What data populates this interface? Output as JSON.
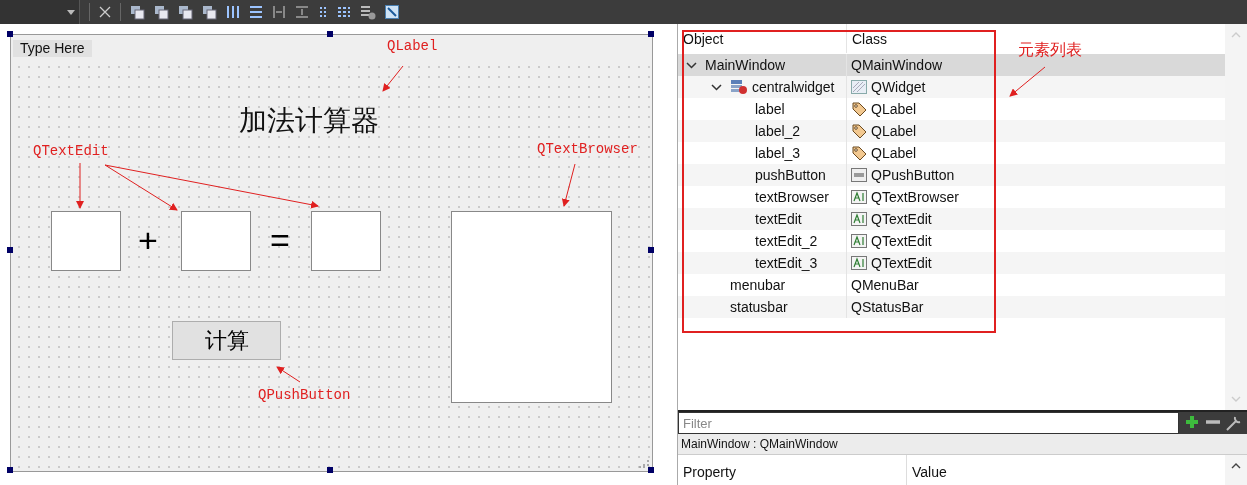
{
  "form": {
    "menu_placeholder": "Type Here",
    "title": "加法计算器",
    "operators": [
      "+",
      "="
    ],
    "button": "计算"
  },
  "annotations": [
    {
      "text": "QLabel"
    },
    {
      "text": "QTextEdit"
    },
    {
      "text": "QTextBrowser"
    },
    {
      "text": "QPushButton"
    },
    {
      "text": "元素列表"
    }
  ],
  "object_inspector": {
    "columns": [
      "Object",
      "Class"
    ],
    "tree": [
      {
        "name": "MainWindow",
        "class": "QMainWindow",
        "expanded": true,
        "selected": true,
        "children": [
          {
            "name": "centralwidget",
            "class": "QWidget",
            "kind": "widget",
            "expanded": true,
            "selected": false,
            "children": [
              {
                "name": "label",
                "class": "QLabel",
                "kind": "label",
                "selected": false
              },
              {
                "name": "label_2",
                "class": "QLabel",
                "kind": "label",
                "selected": false
              },
              {
                "name": "label_3",
                "class": "QLabel",
                "kind": "label",
                "selected": false
              },
              {
                "name": "pushButton",
                "class": "QPushButton",
                "kind": "button",
                "selected": false
              },
              {
                "name": "textBrowser",
                "class": "QTextBrowser",
                "kind": "text",
                "selected": false
              },
              {
                "name": "textEdit",
                "class": "QTextEdit",
                "kind": "text",
                "selected": false
              },
              {
                "name": "textEdit_2",
                "class": "QTextEdit",
                "kind": "text",
                "selected": false
              },
              {
                "name": "textEdit_3",
                "class": "QTextEdit",
                "kind": "text",
                "selected": false
              }
            ]
          },
          {
            "name": "menubar",
            "class": "QMenuBar",
            "selected": false
          },
          {
            "name": "statusbar",
            "class": "QStatusBar",
            "selected": false
          }
        ]
      }
    ]
  },
  "filter": {
    "placeholder": "Filter"
  },
  "selection_label": "MainWindow : QMainWindow",
  "property_editor": {
    "columns": [
      "Property",
      "Value"
    ]
  }
}
